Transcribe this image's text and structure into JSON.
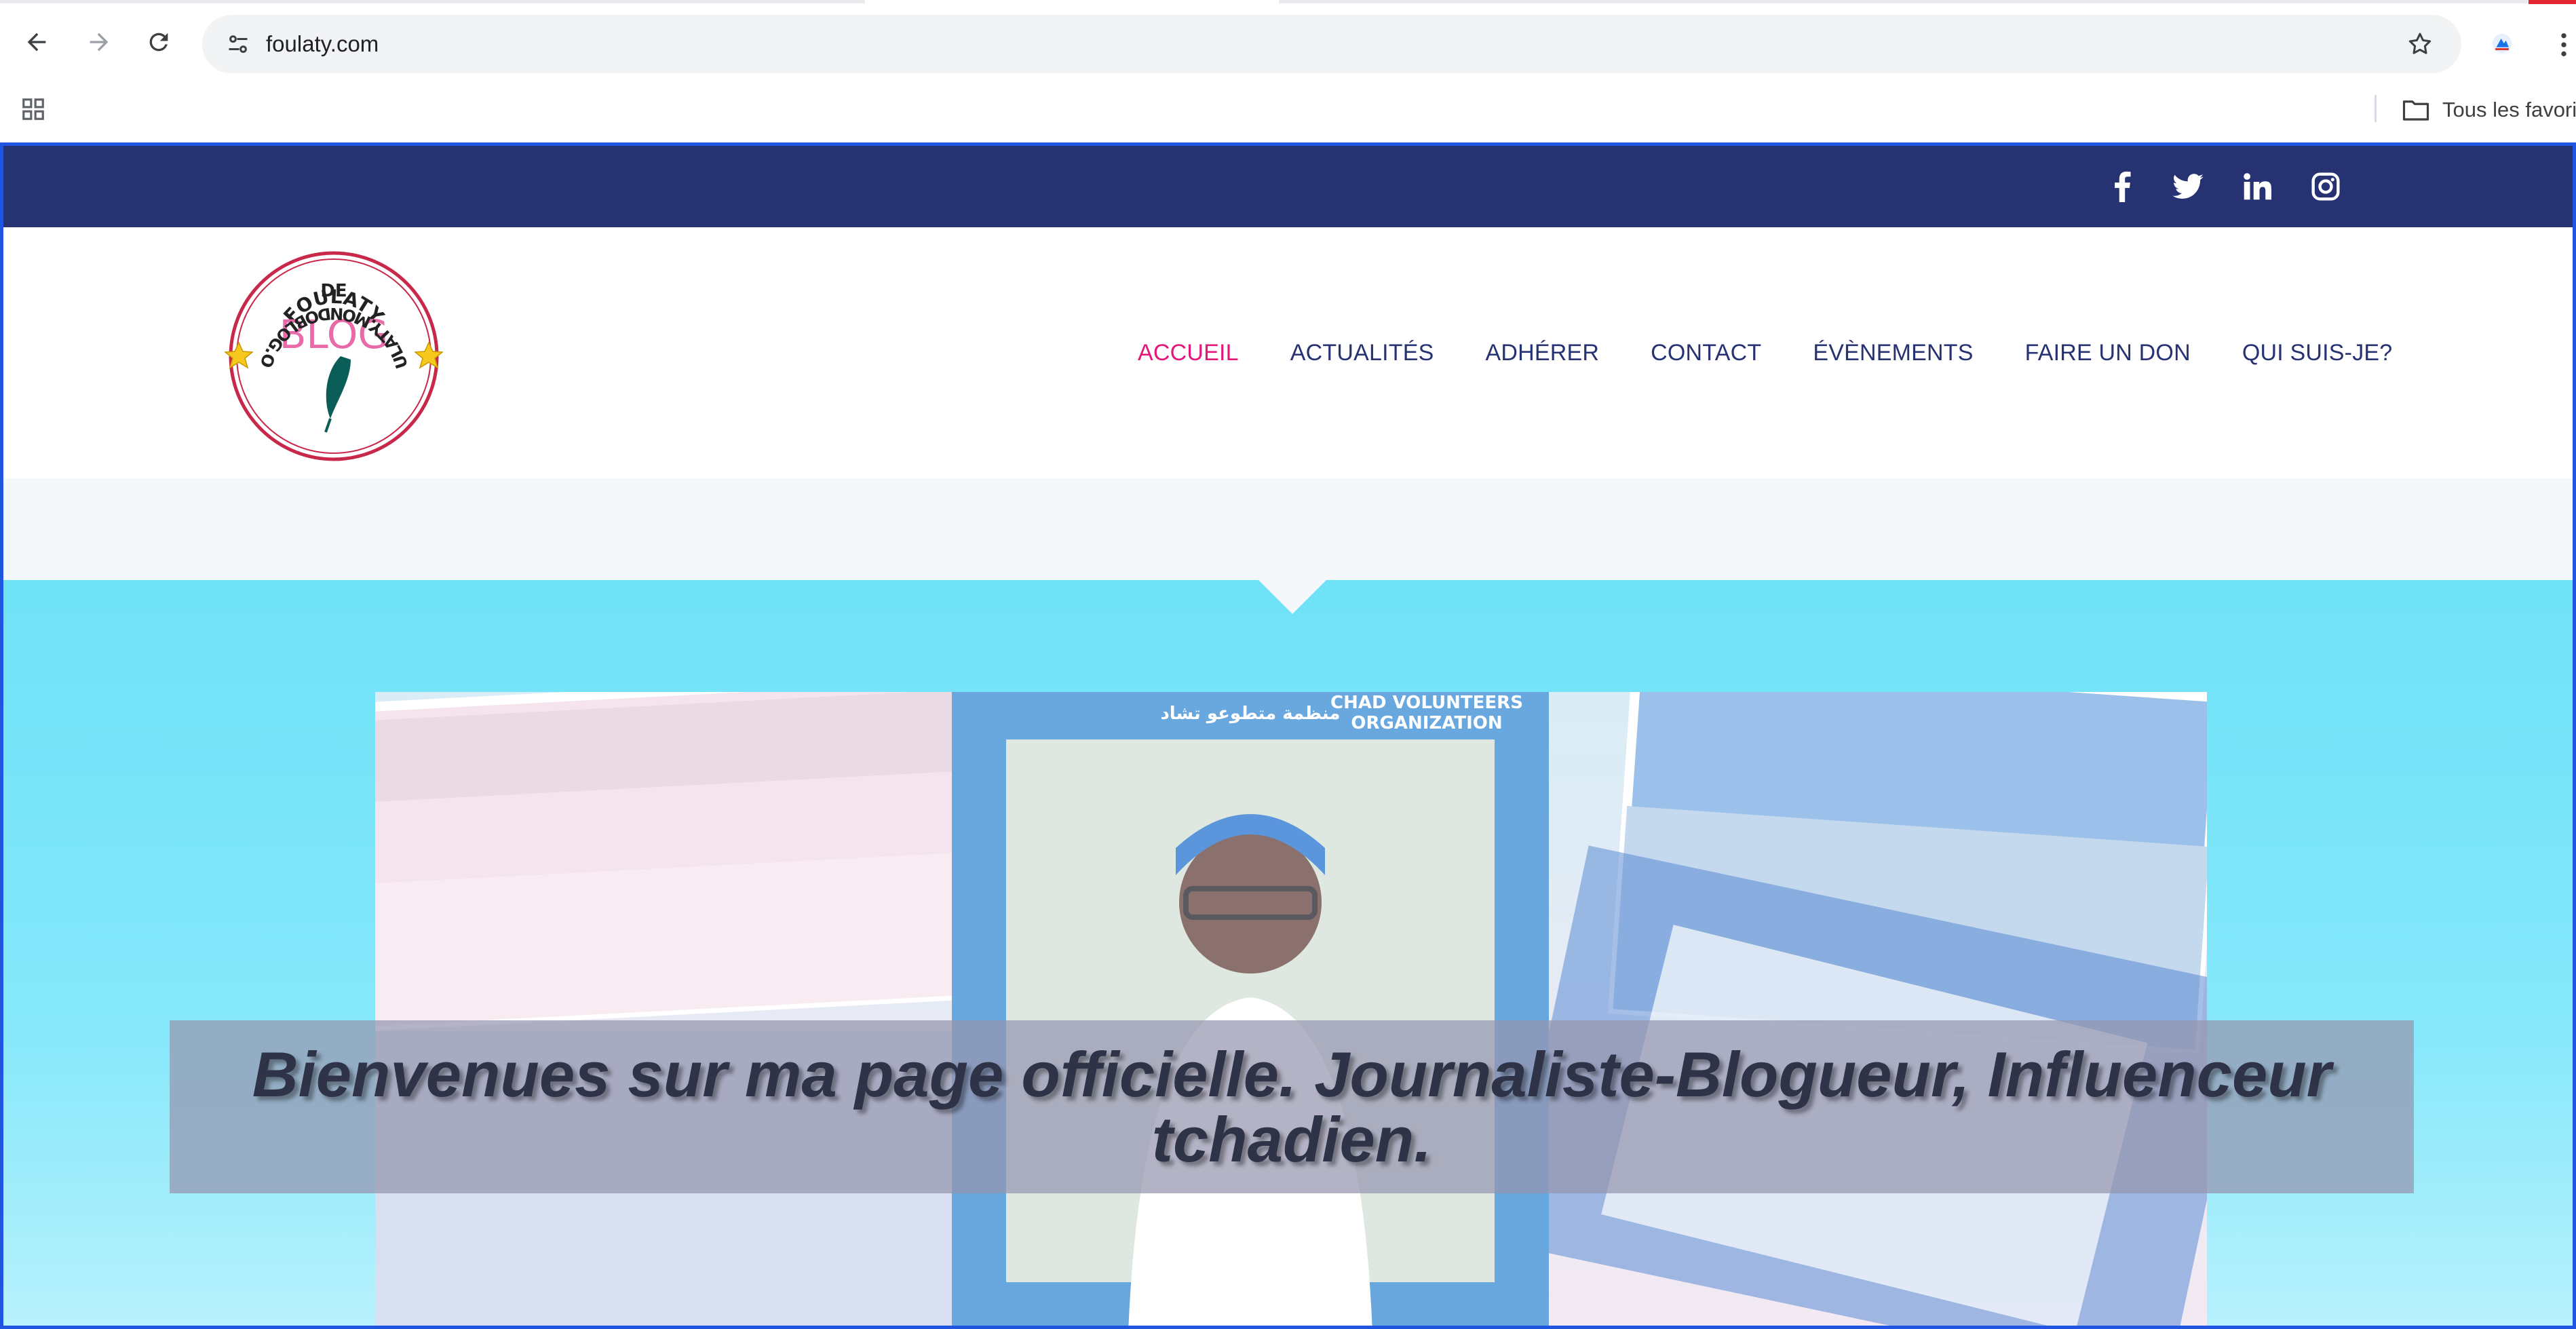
{
  "browser": {
    "url": "foulaty.com",
    "bookmarks_all_label": "Tous les favoris"
  },
  "site": {
    "social_icons": [
      "facebook-icon",
      "twitter-icon",
      "linkedin-icon",
      "instagram-icon"
    ],
    "logo": {
      "top_text": "FOULATY",
      "middle_text": "DE",
      "main_text": "BLOG",
      "ring_text": "FOULATY.MONDOBLOG.ORG"
    },
    "nav": [
      {
        "label": "ACCUEIL",
        "active": true
      },
      {
        "label": "ACTUALITÉS",
        "active": false
      },
      {
        "label": "ADHÉRER",
        "active": false
      },
      {
        "label": "CONTACT",
        "active": false
      },
      {
        "label": "ÉVÈNEMENTS",
        "active": false
      },
      {
        "label": "FAIRE UN DON",
        "active": false
      },
      {
        "label": "QUI SUIS-JE?",
        "active": false
      }
    ],
    "hero": {
      "headline": "Bienvenues sur ma page officielle. Journaliste-Blogueur, Influenceur tchadien.",
      "banner_texts": [
        "CHAD VOLUNTEERS",
        "ORGANIZATION",
        "منظمة متطوعو تشاد"
      ]
    }
  },
  "colors": {
    "topbar": "#273272",
    "nav_text": "#273272",
    "nav_active": "#e3177a",
    "hero_bg": "#6fe1f7",
    "logo_pink": "#e86aa8",
    "logo_ring": "#c8284a"
  }
}
